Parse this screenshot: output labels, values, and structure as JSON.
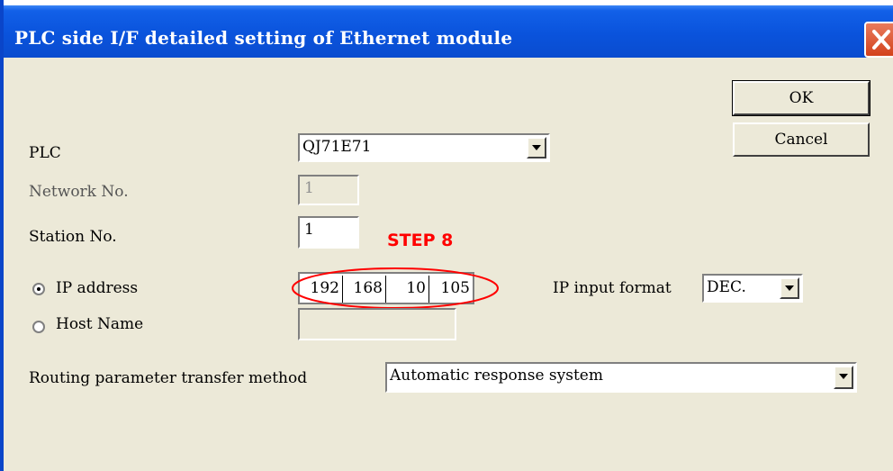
{
  "window": {
    "title": "PLC side I/F detailed setting of Ethernet module"
  },
  "buttons": {
    "ok": "OK",
    "cancel": "Cancel"
  },
  "fields": {
    "plc": {
      "label": "PLC",
      "value": "QJ71E71"
    },
    "network_no": {
      "label": "Network No.",
      "value": "1"
    },
    "station_no": {
      "label": "Station No.",
      "value": "1"
    },
    "ip_address": {
      "label": "IP address",
      "selected": true,
      "octets": [
        "192",
        "168",
        "10",
        "105"
      ]
    },
    "host_name": {
      "label": "Host Name",
      "selected": false,
      "value": ""
    },
    "ip_input_format": {
      "label": "IP input format",
      "value": "DEC."
    },
    "routing": {
      "label": "Routing parameter transfer method",
      "value": "Automatic response system"
    }
  },
  "annotation": {
    "text": "STEP 8",
    "color": "#ff0000"
  },
  "colors": {
    "titlebar": "#0a53dc",
    "dialog_bg": "#ece9d8",
    "close_button": "#d3421c"
  }
}
